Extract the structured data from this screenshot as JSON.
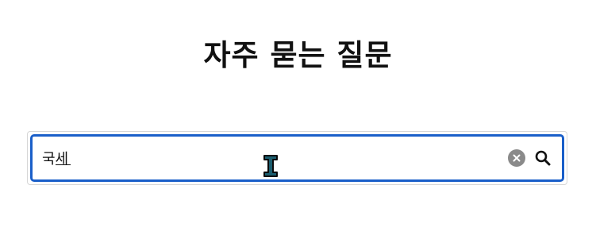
{
  "page": {
    "title": "자주 묻는 질문"
  },
  "search": {
    "value": "국세",
    "placeholder": "",
    "clear_icon": "clear-icon",
    "search_icon": "search-icon"
  },
  "colors": {
    "focus_border": "#1a5fc9",
    "clear_button": "#8a8a8a",
    "title": "#111111"
  }
}
